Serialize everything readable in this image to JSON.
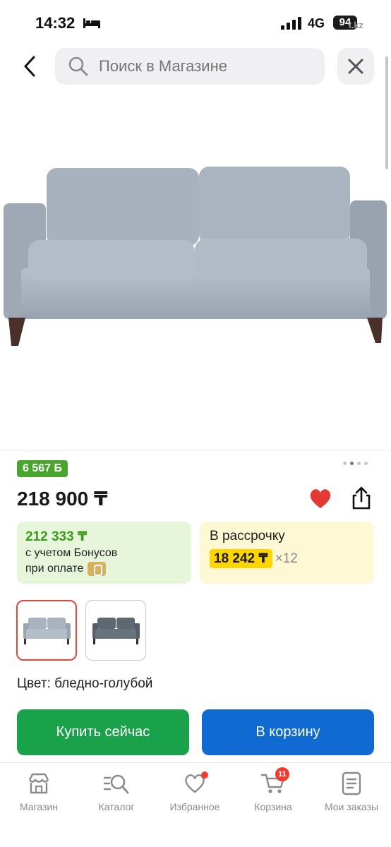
{
  "status_bar": {
    "time": "14:32",
    "network": "4G",
    "battery": "94",
    "watermark": "i.kz"
  },
  "search": {
    "placeholder": "Поиск в Магазине"
  },
  "product": {
    "bonus_badge": "6 567 Б",
    "price": "218 900 ₸",
    "favorite_color": "#e53935",
    "gallery_pages": 4,
    "gallery_active_page": 2
  },
  "bonus_card": {
    "amount": "212 333 ₸",
    "line1": "с учетом Бонусов",
    "line2": "при оплате"
  },
  "installment_card": {
    "title": "В рассрочку",
    "monthly": "18 242 ₸",
    "months": "×12"
  },
  "variants": {
    "selected_color": "#a9b3be",
    "other_color": "#5e6872"
  },
  "color_label": "Цвет: бледно-голубой",
  "actions": {
    "buy_now": "Купить сейчас",
    "add_to_cart": "В корзину"
  },
  "bottom_nav": {
    "items": [
      {
        "label": "Магазин",
        "icon": "store-icon"
      },
      {
        "label": "Каталог",
        "icon": "catalog-search-icon"
      },
      {
        "label": "Избранное",
        "icon": "heart-outline-icon"
      },
      {
        "label": "Корзина",
        "icon": "cart-icon",
        "badge": "11"
      },
      {
        "label": "Мои заказы",
        "icon": "orders-icon"
      }
    ]
  },
  "colors": {
    "brand_green": "#1aa24a",
    "brand_blue": "#0f6ad1",
    "badge_red": "#ef3b2d"
  }
}
